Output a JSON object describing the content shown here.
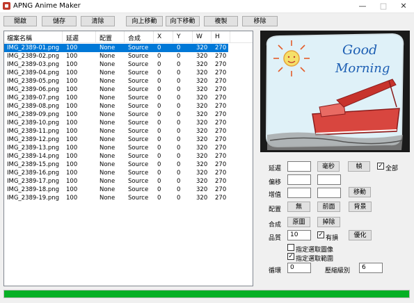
{
  "window": {
    "title": "APNG Anime Maker"
  },
  "toolbar": {
    "open": "開啟",
    "save": "儲存",
    "clear": "清除",
    "move_up": "向上移動",
    "move_down": "向下移動",
    "copy": "複製",
    "move": "移除"
  },
  "table": {
    "headers": [
      "檔案名稱",
      "延遲",
      "配置",
      "合成",
      "X",
      "Y",
      "W",
      "H"
    ],
    "rows": [
      [
        "IMG_2389-01.png",
        "100",
        "None",
        "Source",
        "0",
        "0",
        "320",
        "270"
      ],
      [
        "IMG_2389-02.png",
        "100",
        "None",
        "Source",
        "0",
        "0",
        "320",
        "270"
      ],
      [
        "IMG_2389-03.png",
        "100",
        "None",
        "Source",
        "0",
        "0",
        "320",
        "270"
      ],
      [
        "IMG_2389-04.png",
        "100",
        "None",
        "Source",
        "0",
        "0",
        "320",
        "270"
      ],
      [
        "IMG_2389-05.png",
        "100",
        "None",
        "Source",
        "0",
        "0",
        "320",
        "270"
      ],
      [
        "IMG_2389-06.png",
        "100",
        "None",
        "Source",
        "0",
        "0",
        "320",
        "270"
      ],
      [
        "IMG_2389-07.png",
        "100",
        "None",
        "Source",
        "0",
        "0",
        "320",
        "270"
      ],
      [
        "IMG_2389-08.png",
        "100",
        "None",
        "Source",
        "0",
        "0",
        "320",
        "270"
      ],
      [
        "IMG_2389-09.png",
        "100",
        "None",
        "Source",
        "0",
        "0",
        "320",
        "270"
      ],
      [
        "IMG_2389-10.png",
        "100",
        "None",
        "Source",
        "0",
        "0",
        "320",
        "270"
      ],
      [
        "IMG_2389-11.png",
        "100",
        "None",
        "Source",
        "0",
        "0",
        "320",
        "270"
      ],
      [
        "IMG_2389-12.png",
        "100",
        "None",
        "Source",
        "0",
        "0",
        "320",
        "270"
      ],
      [
        "IMG_2389-13.png",
        "100",
        "None",
        "Source",
        "0",
        "0",
        "320",
        "270"
      ],
      [
        "IMG_2389-14.png",
        "100",
        "None",
        "Source",
        "0",
        "0",
        "320",
        "270"
      ],
      [
        "IMG_2389-15.png",
        "100",
        "None",
        "Source",
        "0",
        "0",
        "320",
        "270"
      ],
      [
        "IMG_2389-16.png",
        "100",
        "None",
        "Source",
        "0",
        "0",
        "320",
        "270"
      ],
      [
        "IMG_2389-17.png",
        "100",
        "None",
        "Source",
        "0",
        "0",
        "320",
        "270"
      ],
      [
        "IMG_2389-18.png",
        "100",
        "None",
        "Source",
        "0",
        "0",
        "320",
        "270"
      ],
      [
        "IMG_2389-19.png",
        "100",
        "None",
        "Source",
        "0",
        "0",
        "320",
        "270"
      ]
    ],
    "selected_index": 0
  },
  "preview": {
    "text_line1": "Good",
    "text_line2": "Morning"
  },
  "settings": {
    "delay_label": "延遲",
    "delay_unit_button": "毫秒",
    "frame_button": "幀",
    "all_label": "全部",
    "all_checked": true,
    "offset_label": "偏移",
    "increment_label": "增值",
    "move_button": "移動",
    "dispose_label": "配置",
    "dispose_none": "無",
    "dispose_front": "前面",
    "dispose_back": "背景",
    "blend_label": "合成",
    "blend_source": "原圖",
    "blend_over": "掉除",
    "quality_label": "品質",
    "quality_value": "10",
    "lossy_label": "有損",
    "lossy_checked": true,
    "optimize_button": "優化",
    "opt_select_image_label": "指定選取圖像",
    "opt_select_image_checked": false,
    "opt_select_range_label": "指定選取範圍",
    "opt_select_range_checked": true,
    "loop_label": "循環",
    "loop_value": "0",
    "compression_label": "壓縮級別",
    "compression_value": "6"
  },
  "status": {
    "progress": 1.0
  },
  "colors": {
    "progress": "#06b025",
    "selection": "#0078d7"
  }
}
